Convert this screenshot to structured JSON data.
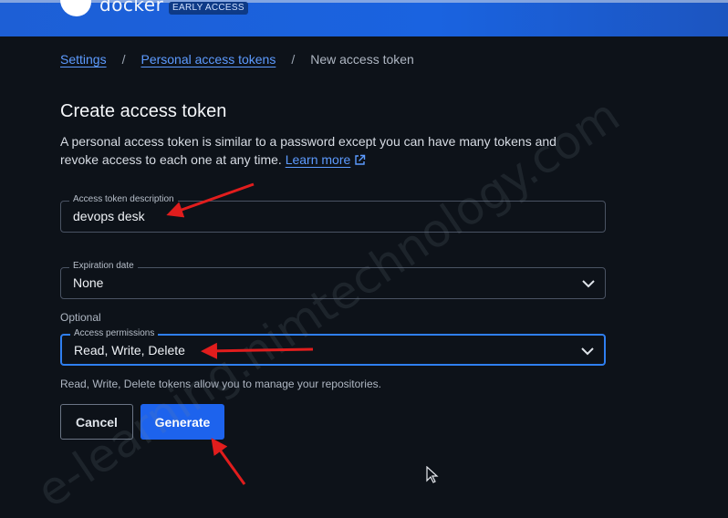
{
  "header": {
    "brand": "docker",
    "badge": "EARLY ACCESS"
  },
  "breadcrumb": {
    "items": [
      "Settings",
      "Personal access tokens",
      "New access token"
    ],
    "separator": "/"
  },
  "page": {
    "title": "Create access token",
    "description": "A personal access token is similar to a password except you can have many tokens and revoke access to each one at any time.",
    "learn_more": "Learn more"
  },
  "form": {
    "description_field": {
      "label": "Access token description",
      "value": "devops desk"
    },
    "expiration_field": {
      "label": "Expiration date",
      "value": "None"
    },
    "optional_label": "Optional",
    "permissions_field": {
      "label": "Access permissions",
      "value": "Read, Write, Delete"
    },
    "permissions_helper": "Read, Write, Delete tokens allow you to manage your repositories."
  },
  "buttons": {
    "cancel": "Cancel",
    "generate": "Generate"
  },
  "watermark": "e-learning.nimtechnology.com",
  "colors": {
    "accent": "#1d63ed",
    "link": "#5d9bff",
    "annotation": "#e11d1d",
    "background": "#0d1219"
  }
}
